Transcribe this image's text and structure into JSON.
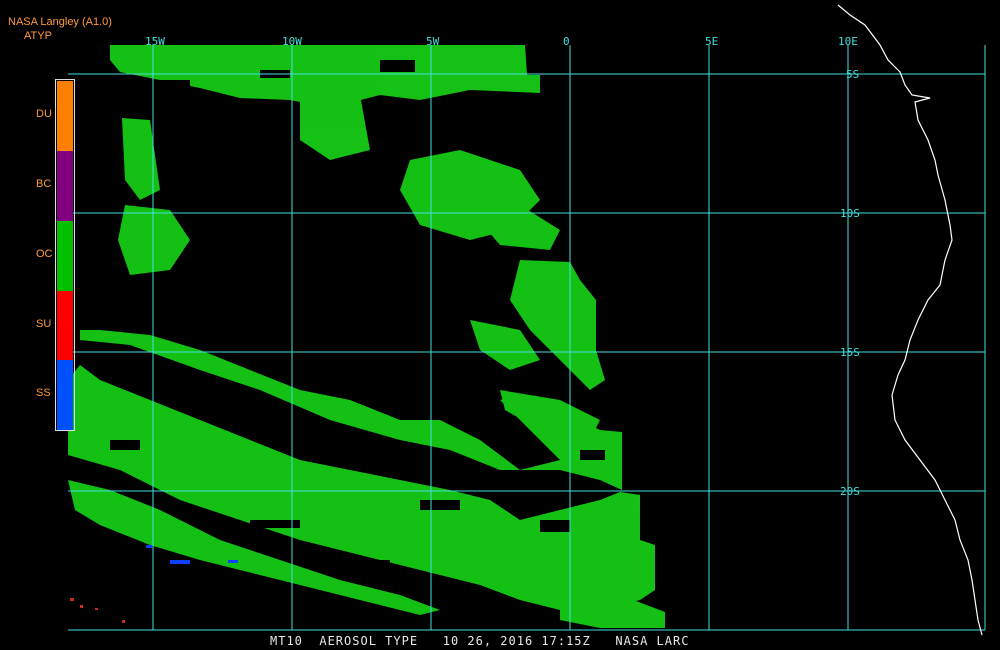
{
  "header": {
    "title": "NASA Langley (A1.0)",
    "product": "ATYP"
  },
  "legend": [
    {
      "code": "DU",
      "color": "#ff8000"
    },
    {
      "code": "BC",
      "color": "#800080"
    },
    {
      "code": "OC",
      "color": "#00c000"
    },
    {
      "code": "SU",
      "color": "#ff0000"
    },
    {
      "code": "SS",
      "color": "#0050ff"
    }
  ],
  "map": {
    "longitude_labels": [
      "15W",
      "10W",
      "5W",
      "0",
      "5E",
      "10E"
    ],
    "latitude_labels": [
      "5S",
      "10S",
      "15S",
      "20S"
    ],
    "grid_color": "#40e0e0",
    "coastline_color": "#ffffff",
    "dominant_aerosol": "OC"
  },
  "footer": "MT10  AEROSOL TYPE   10 26, 2016 17:15Z   NASA LARC"
}
